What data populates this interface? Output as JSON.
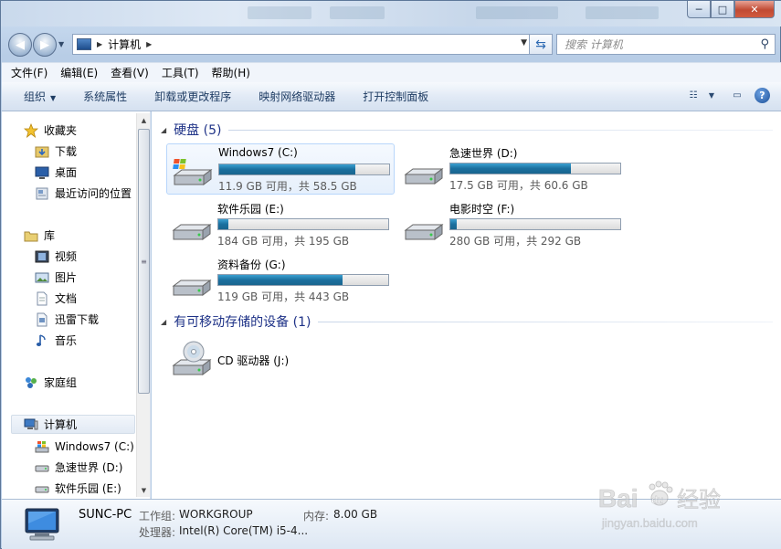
{
  "window": {
    "minimize": "─",
    "maximize": "□",
    "close": "✕"
  },
  "address": {
    "crumb": "计算机",
    "search_placeholder": "搜索 计算机"
  },
  "menu": [
    "文件(F)",
    "编辑(E)",
    "查看(V)",
    "工具(T)",
    "帮助(H)"
  ],
  "commands": {
    "organize": "组织",
    "items": [
      "系统属性",
      "卸载或更改程序",
      "映射网络驱动器",
      "打开控制面板"
    ]
  },
  "nav": {
    "favorites": "收藏夹",
    "fav_items": [
      "下载",
      "桌面",
      "最近访问的位置"
    ],
    "libraries": "库",
    "lib_items": [
      "视频",
      "图片",
      "文档",
      "迅雷下载",
      "音乐"
    ],
    "homegroup": "家庭组",
    "computer": "计算机",
    "comp_items": [
      "Windows7 (C:)",
      "急速世界 (D:)",
      "软件乐园 (E:)"
    ]
  },
  "groups": {
    "hdd": "硬盘 (5)",
    "removable": "有可移动存储的设备 (1)"
  },
  "drives": [
    {
      "name": "Windows7 (C:)",
      "size": "11.9 GB 可用，共 58.5 GB",
      "used_pct": 80,
      "selected": true
    },
    {
      "name": "急速世界 (D:)",
      "size": "17.5 GB 可用，共 60.6 GB",
      "used_pct": 71
    },
    {
      "name": "软件乐园 (E:)",
      "size": "184 GB 可用，共 195 GB",
      "used_pct": 6
    },
    {
      "name": "电影时空 (F:)",
      "size": "280 GB 可用，共 292 GB",
      "used_pct": 4
    },
    {
      "name": "资料备份 (G:)",
      "size": "119 GB 可用，共 443 GB",
      "used_pct": 73
    }
  ],
  "cd": {
    "name": "CD 驱动器 (J:)"
  },
  "details": {
    "pc_name": "SUNC-PC",
    "workgroup_label": "工作组:",
    "workgroup": "WORKGROUP",
    "memory_label": "内存:",
    "memory": "8.00 GB",
    "cpu_label": "处理器:",
    "cpu": "Intel(R) Core(TM) i5-4..."
  },
  "watermark": {
    "brand": "Bai",
    "brand2": "du",
    "cn": "经验",
    "url": "jingyan.baidu.com"
  }
}
